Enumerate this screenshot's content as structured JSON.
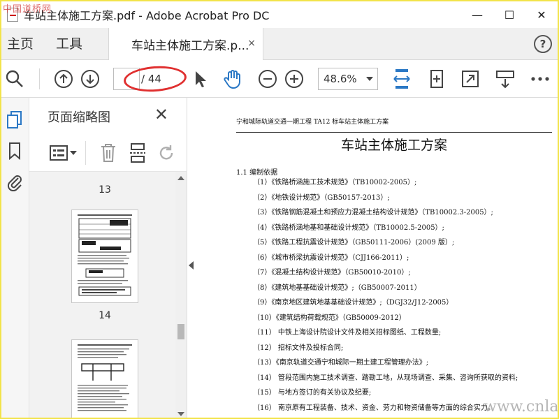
{
  "window": {
    "title": "车站主体施工方案.pdf - Adobe Acrobat Pro DC",
    "watermark_top": "中国道桥网",
    "minimize": "—",
    "maximize": "☐",
    "close": "✕"
  },
  "tabs": {
    "home": "主页",
    "tools": "工具",
    "document": "车站主体施工方案.p...",
    "close": "×",
    "help": "?"
  },
  "toolbar": {
    "page_current": "",
    "page_total": "/ 44",
    "zoom": "48.6%"
  },
  "panel": {
    "title": "页面缩略图",
    "close": "✕",
    "pages": [
      "13",
      "14"
    ]
  },
  "document": {
    "header": "宁和城际轨道交通一期工程 TA12 标车站主体施工方案",
    "title": "车站主体施工方案",
    "section": "1.1 编制依据",
    "lines": [
      "（1）《铁路桥涵施工技术规范》（TB10002-2005）;",
      "（2）《地铁设计规范》（GB50157-2013）;",
      "（3）《铁路钢筋混凝土和预应力混凝土结构设计规范》（TB10002.3-2005）;",
      "（4）《铁路桥涵地基和基础设计规范》（TB10002.5-2005）;",
      "（5）《铁路工程抗震设计规范》（GB50111-2006）(2009 版）;",
      "（6）《城市桥梁抗震设计规范》（CJJ166-2011）;",
      "（7）《混凝土结构设计规范》（GB50010-2010）;",
      "（8）《建筑地基基础设计规范》;（GB50007-2011）",
      "（9）《南京地区建筑地基基础设计规范》;（DGJ32/J12-2005）",
      "（10）《建筑结构荷载规范》（GB50009-2012）",
      "（11） 中铁上海设计院设计文件及相关招标图纸、工程数量;",
      "（12） 招标文件及投标合同;",
      "（13）《南京轨道交通宁和城际一期土建工程管理办法》;",
      "（14） 管段范围内施工技术调查、踏勘工地，从现场调查、采集、咨询所获取的资料;",
      "（15） 与地方签订的有关协议及纪要;",
      "（16） 南京原有工程装备、技术、资金、劳力和物资储备等方面的综合实力。"
    ],
    "watermark": "www.cnlao.com"
  },
  "colors": {
    "accent_blue": "#2b78c5",
    "annotation_red": "#e03030",
    "frame_yellow": "#f2e34a"
  }
}
